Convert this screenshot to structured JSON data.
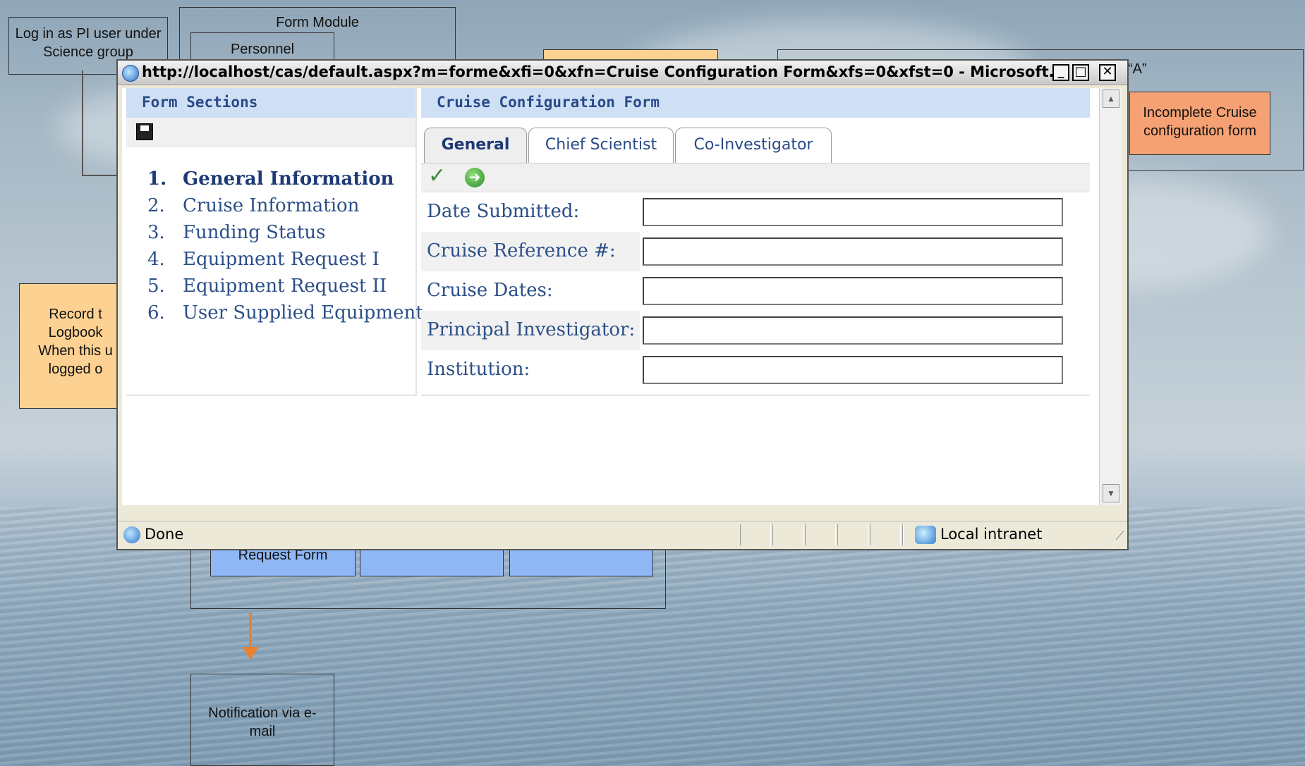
{
  "diagram": {
    "login_box": "Log in as PI user under Science group",
    "form_module_label": "Form Module",
    "personnel_label": "Personnel",
    "record_box": "Record t Logbook When this u logged o",
    "incomplete_box": "Incomplete Cruise configuration form",
    "a_label": "“A”",
    "request_form_label": "Request Form",
    "notification_box": "Notification via e-mail"
  },
  "window": {
    "title": "http://localhost/cas/default.aspx?m=forme&xfi=0&xfn=Cruise Configuration Form&xfs=0&xfst=0 - Microsoft...",
    "minimize": "_",
    "maximize": "□",
    "close": "✕"
  },
  "left_panel": {
    "title": "Form Sections",
    "sections": [
      {
        "num": "1.",
        "label": "General Information"
      },
      {
        "num": "2.",
        "label": "Cruise Information"
      },
      {
        "num": "3.",
        "label": "Funding Status"
      },
      {
        "num": "4.",
        "label": "Equipment Request I"
      },
      {
        "num": "5.",
        "label": "Equipment Request II"
      },
      {
        "num": "6.",
        "label": "User Supplied Equipment"
      }
    ]
  },
  "right_panel": {
    "title": "Cruise Configuration Form",
    "tabs": [
      "General",
      "Chief Scientist",
      "Co-Investigator"
    ],
    "fields": [
      {
        "label": "Date Submitted:",
        "value": ""
      },
      {
        "label": "Cruise Reference #:",
        "value": ""
      },
      {
        "label": "Cruise Dates:",
        "value": ""
      },
      {
        "label": "Principal Investigator:",
        "value": ""
      },
      {
        "label": "Institution:",
        "value": ""
      }
    ]
  },
  "status_bar": {
    "status": "Done",
    "zone": "Local intranet"
  },
  "icons": {
    "save": "floppy-disk-icon",
    "check": "checkmark-icon",
    "go": "green-arrow-icon"
  }
}
